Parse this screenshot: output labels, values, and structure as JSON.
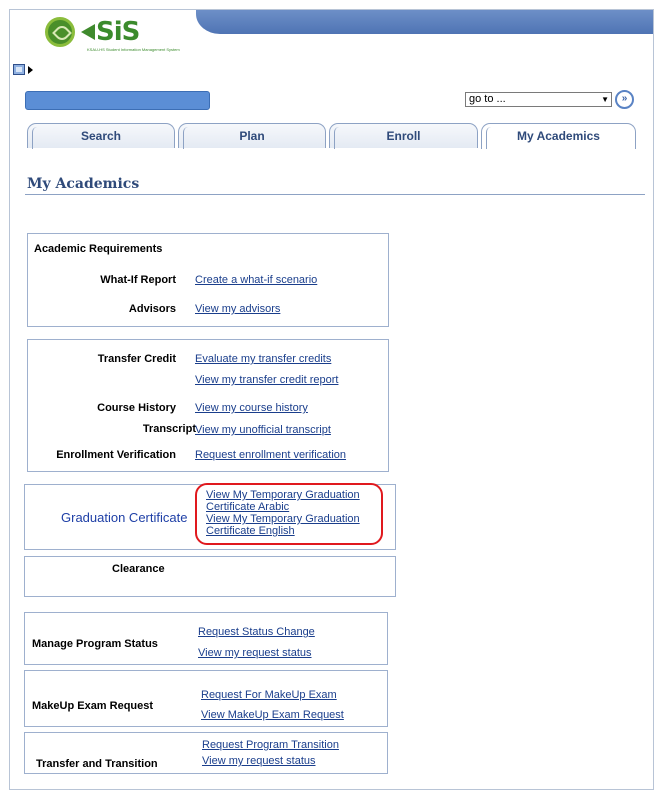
{
  "header": {
    "logo_text": "SiS",
    "logo_subtitle": "KSAU-HS Student Information Management System",
    "goto_selected": "go to ...",
    "goto_button_glyph": "»"
  },
  "tabs": [
    {
      "label": "Search",
      "active": false
    },
    {
      "label": "Plan",
      "active": false
    },
    {
      "label": "Enroll",
      "active": false
    },
    {
      "label": "My Academics",
      "active": true
    }
  ],
  "page": {
    "title": "My Academics"
  },
  "sections": {
    "academic_requirements": {
      "heading": "Academic Requirements",
      "whatif_label": "What-If Report",
      "whatif_link": "Create a what-if scenario",
      "advisors_label": "Advisors",
      "advisors_link": "View my advisors"
    },
    "transfer": {
      "transfer_label": "Transfer Credit",
      "transfer_link1": "Evaluate my transfer credits",
      "transfer_link2": "View my transfer credit report",
      "course_history_label": "Course History",
      "course_history_link": "View my course history",
      "transcript_label": "Transcript",
      "transcript_link": "View my unofficial transcript",
      "enroll_verif_label": "Enrollment Verification",
      "enroll_verif_link": "Request enrollment verification"
    },
    "graduation": {
      "label": "Graduation Certificate",
      "link_arabic_1": "View My Temporary Graduation",
      "link_arabic_2": "Certificate Arabic",
      "link_english_1": "View My Temporary Graduation",
      "link_english_2": "Certificate English"
    },
    "clearance": {
      "label": "Clearance"
    },
    "program_status": {
      "label": "Manage Program Status",
      "link1": "Request Status Change",
      "link2": "View my request status"
    },
    "makeup": {
      "label": "MakeUp Exam Request",
      "link1": "Request For MakeUp Exam",
      "link2": "View MakeUp Exam Request"
    },
    "transition": {
      "label": "Transfer and Transition",
      "link1": "Request Program Transition",
      "link2": "View my request status"
    }
  },
  "colors": {
    "accent": "#2f4a7a",
    "link": "#1a3e8c",
    "highlight": "#e0191e",
    "brand": "#3b8b2c"
  }
}
